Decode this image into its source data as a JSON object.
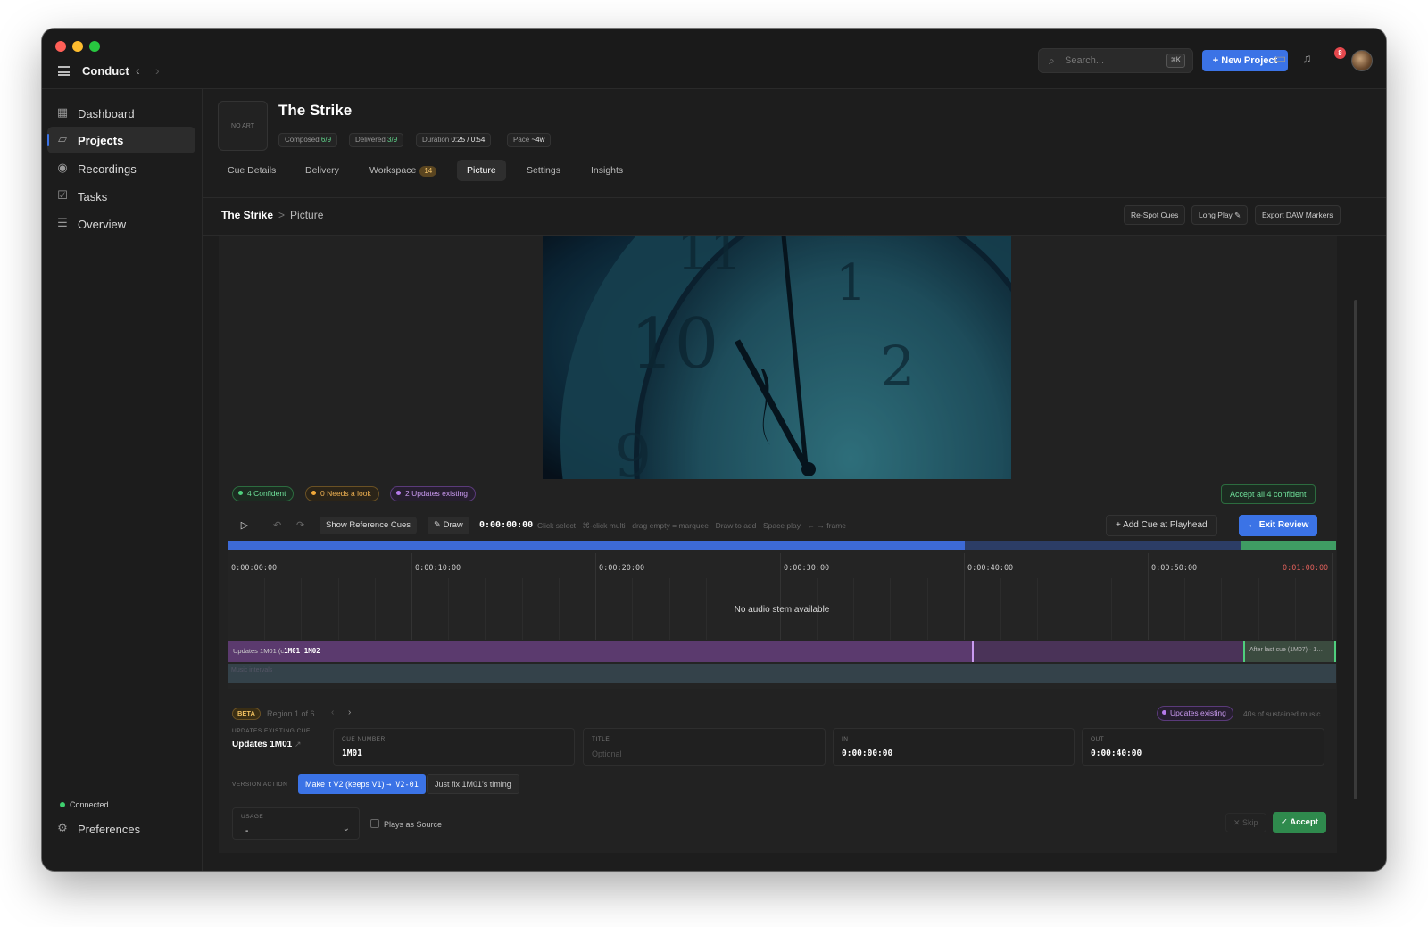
{
  "app": {
    "name": "Conduct"
  },
  "search": {
    "placeholder": "Search...",
    "shortcut": "⌘K"
  },
  "header": {
    "new_project_label": "+ New Project",
    "notifications_count": "8"
  },
  "sidebar": {
    "items": [
      {
        "label": "Dashboard",
        "icon": "grid-icon"
      },
      {
        "label": "Projects",
        "icon": "folder-icon",
        "active": true
      },
      {
        "label": "Recordings",
        "icon": "record-icon"
      },
      {
        "label": "Tasks",
        "icon": "checkbox-icon"
      },
      {
        "label": "Overview",
        "icon": "list-icon"
      }
    ],
    "status": "Connected",
    "preferences_label": "Preferences"
  },
  "project": {
    "art_placeholder": "NO ART",
    "title": "The Strike",
    "stats": {
      "composed_label": "Composed",
      "composed_value": "6/9",
      "delivered_label": "Delivered",
      "delivered_value": "3/9",
      "duration_label": "Duration",
      "duration_value": "0:25 / 0:54",
      "pace_label": "Pace",
      "pace_value": "~4w"
    },
    "tabs": [
      "Cue Details",
      "Delivery",
      "Workspace",
      "Picture",
      "Settings",
      "Insights"
    ],
    "workspace_count": "14",
    "active_tab": "Picture"
  },
  "breadcrumb": {
    "project": "The Strike",
    "separator": ">",
    "page": "Picture"
  },
  "actions": {
    "respot": "Re-Spot Cues",
    "long_play": "Long Play ✎",
    "export": "Export DAW Markers"
  },
  "review": {
    "confident": "4 Confident",
    "needs_look": "0 Needs a look",
    "updates_existing": "2 Updates existing",
    "accept_all": "Accept all 4 confident"
  },
  "toolbar": {
    "show_ref": "Show Reference Cues",
    "draw": "✎ Draw",
    "timecode": "0:00:00:00",
    "hint": "Click select · ⌘-click multi · drag empty = marquee · Draw to add · Space play · ← → frame",
    "add_cue": "+ Add Cue at Playhead",
    "exit_review": "← Exit Review"
  },
  "timeline": {
    "ticks": [
      "0:00:00:00",
      "0:00:10:00",
      "0:00:20:00",
      "0:00:30:00",
      "0:00:40:00",
      "0:00:50:00",
      "0:01:00:00"
    ],
    "no_audio": "No audio stem available",
    "region_label": "Updates 1M01 (c",
    "region_cues": "1M01 1M02",
    "end_label": "After last cue (1M07) · 1…",
    "music_label": "Music intervals"
  },
  "detail": {
    "beta": "BETA",
    "region_of": "Region 1 of 6",
    "status_pill": "Updates existing",
    "sustain": "40s of sustained music",
    "updates_label": "UPDATES EXISTING CUE",
    "updates_value": "Updates 1M01",
    "cue_number_label": "CUE NUMBER",
    "cue_number_value": "1M01",
    "title_label": "TITLE",
    "title_placeholder": "Optional",
    "in_label": "IN",
    "in_value": "0:00:00:00",
    "out_label": "OUT",
    "out_value": "0:00:40:00",
    "version_action_label": "VERSION ACTION",
    "version_primary": "Make it V2 (keeps V1)",
    "version_primary_suffix": "→ V2-01",
    "version_alt": "Just fix 1M01's timing",
    "usage_label": "USAGE",
    "usage_value": "-",
    "plays_as_source": "Plays as Source",
    "skip": "✕ Skip",
    "accept": "✓ Accept"
  }
}
